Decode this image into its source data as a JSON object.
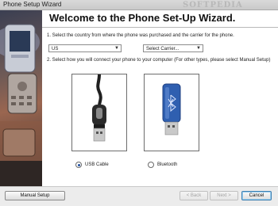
{
  "window": {
    "title": "Phone Setup Wizard",
    "watermark": "SOFTPEDIA"
  },
  "header": {
    "title": "Welcome to the Phone Set-Up Wizard."
  },
  "step1": {
    "text": "1. Select the country from where the phone was purchased and the carrier for the phone.",
    "country": {
      "value": "US"
    },
    "carrier": {
      "value": "Select Carrier..."
    }
  },
  "step2": {
    "text": "2. Select how you will connect your phone to your computer (For other types, please select Manual Setup)",
    "options": [
      {
        "label": "USB Cable",
        "selected": true,
        "icon": "usb-cable-icon"
      },
      {
        "label": "Bluetooth",
        "selected": false,
        "icon": "bluetooth-dongle-icon"
      }
    ]
  },
  "footer": {
    "manual_setup": "Manual Setup",
    "back": "< Back",
    "next": "Next >",
    "cancel": "Cancel"
  },
  "colors": {
    "bluetooth_blue": "#2f5fb0",
    "radio_dot": "#1f4fa0"
  }
}
